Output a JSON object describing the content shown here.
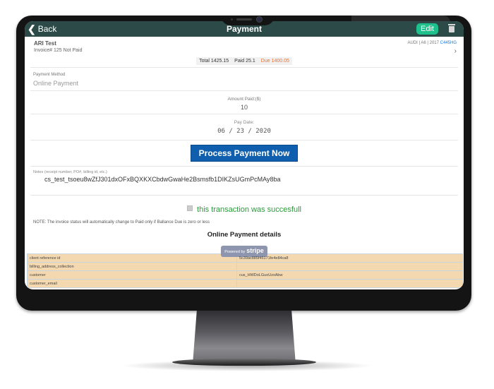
{
  "header": {
    "back_label": "Back",
    "title": "Payment",
    "edit_label": "Edit"
  },
  "invoice": {
    "customer_name": "ARI Test",
    "invoice_status": "Invoice# 125 Not Paid",
    "vehicle": "AUDI | A6 | 2017",
    "plate": "C445HG",
    "total": "Total 1425.15",
    "paid": "Paid 25.1",
    "due": "Due 1400.05"
  },
  "form": {
    "payment_method_label": "Payment Method",
    "payment_method_value": "Online Payment",
    "amount_label": "Amount Paid:($)",
    "amount_value": "10",
    "pay_date_label": "Pay Date:",
    "pay_date_value": "06 / 23 / 2020",
    "process_button": "Process Payment Now",
    "notes_label": "Notes (receipt number, PO#, billing id, etc.)",
    "notes_value": "cs_test_tsoeu8wZfJ301dxOFxBQXKXCbdwGwaHe2Bsmsfb1DIKZsUGmPcMAy8ba"
  },
  "status": {
    "success_message": "this transaction was succesfull",
    "success_checked": true,
    "note": "NOTE: The invoice status will automatically change to Paid only if Ballance Due is zero or less"
  },
  "details": {
    "title": "Online Payment details",
    "powered_by": "Powered by",
    "stripe_label": "stripe",
    "rows": [
      {
        "key": "client reference id",
        "value": "5c39ac885f45171fe4e84ca8"
      },
      {
        "key": "billing_address_collection",
        "value": ""
      },
      {
        "key": "customer",
        "value": "cus_HWDoLGuoUzxAbw"
      },
      {
        "key": "customer_email",
        "value": ""
      }
    ]
  },
  "colors": {
    "header_bg": "#2c4b48",
    "edit_button": "#1ec08c",
    "process_button": "#0f5fae",
    "due_text": "#f0702b",
    "success_text": "#2a9a3a",
    "table_bg": "#f3d8b0",
    "plate_text": "#1a7ee0"
  }
}
